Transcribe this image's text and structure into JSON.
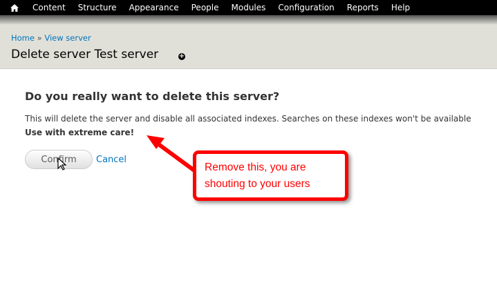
{
  "toolbar": {
    "items": [
      "Content",
      "Structure",
      "Appearance",
      "People",
      "Modules",
      "Configuration",
      "Reports",
      "Help"
    ]
  },
  "breadcrumb": {
    "home": "Home",
    "separator": "»",
    "view_server": "View server"
  },
  "page_title": "Delete server Test server",
  "shortcut_icon": "+",
  "form": {
    "question": "Do you really want to delete this server?",
    "description": "This will delete the server and disable all associated indexes. Searches on these indexes won't be available",
    "warning": "Use with extreme care!",
    "confirm_label": "Confirm",
    "cancel_label": "Cancel"
  },
  "annotation": {
    "text": "Remove this, you are shouting to your users",
    "color": "#ff0000"
  }
}
